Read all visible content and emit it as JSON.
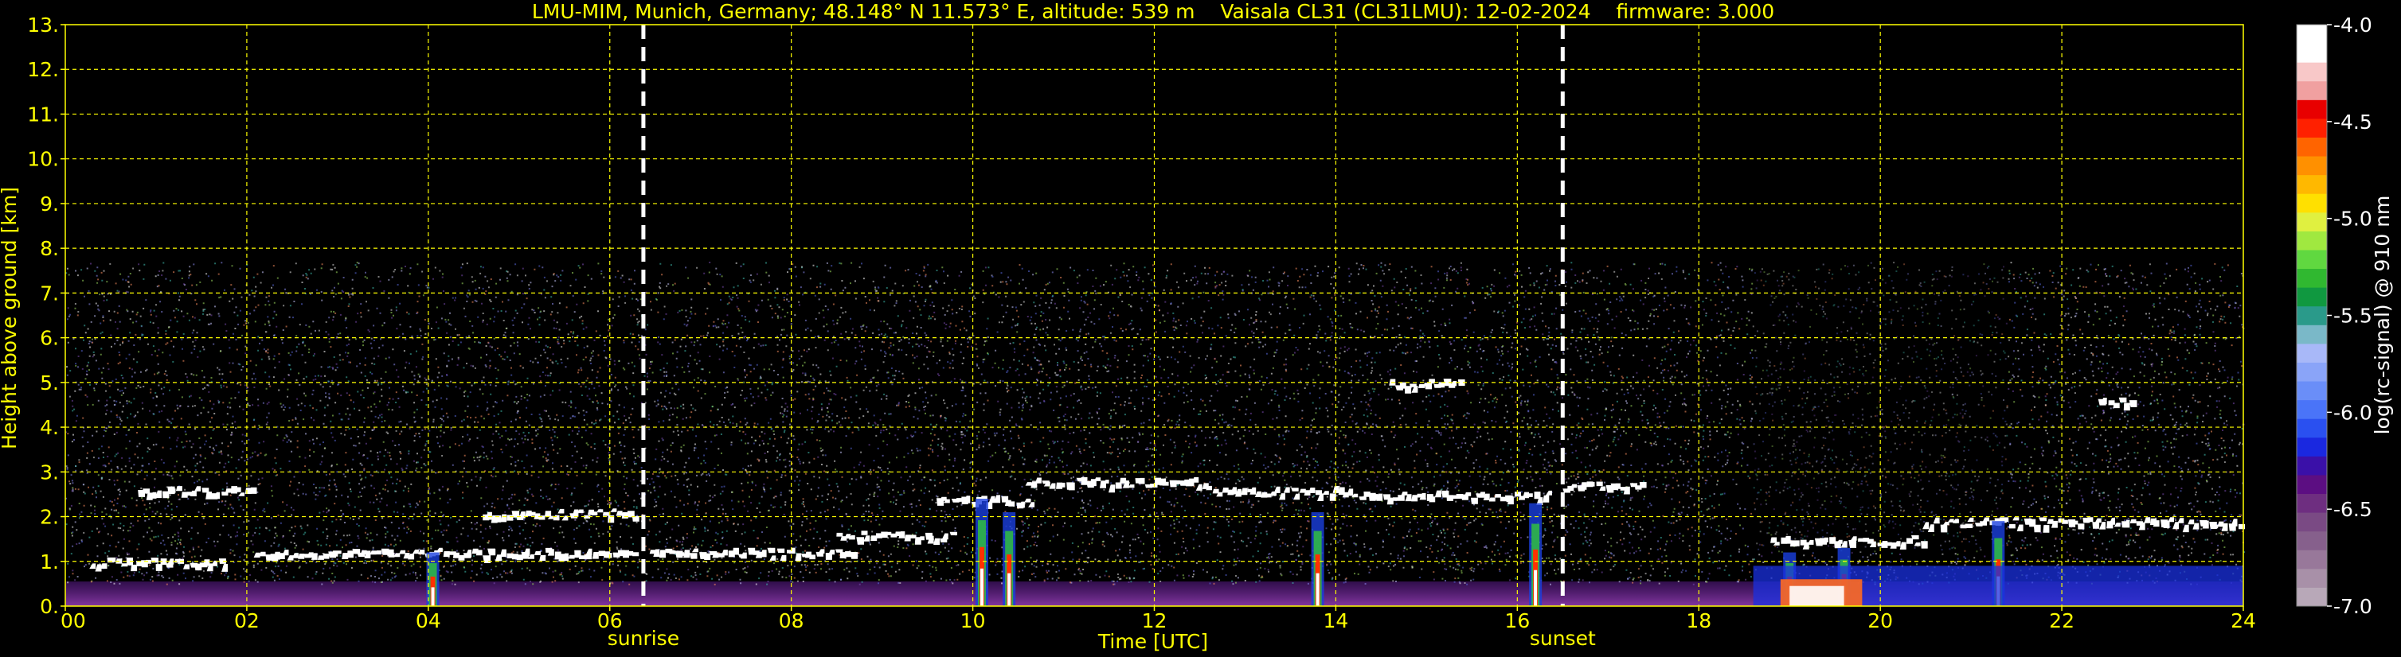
{
  "chart_data": {
    "type": "heatmap",
    "title": "LMU-MIM, Munich, Germany; 48.148° N 11.573° E, altitude: 539 m    Vaisala CL31 (CL31LMU): 12-02-2024    firmware: 3.000",
    "xlabel": "Time [UTC]",
    "ylabel": "Height above ground [km]",
    "xlim": [
      0,
      24
    ],
    "ylim": [
      0,
      13
    ],
    "x_ticks": [
      0,
      2,
      4,
      6,
      8,
      10,
      12,
      14,
      16,
      18,
      20,
      22,
      24
    ],
    "x_tick_labels": [
      "00",
      "02",
      "04",
      "06",
      "08",
      "10",
      "12",
      "14",
      "16",
      "18",
      "20",
      "22",
      "24"
    ],
    "y_ticks": [
      0,
      1,
      2,
      3,
      4,
      5,
      6,
      7,
      8,
      9,
      10,
      11,
      12,
      13
    ],
    "y_tick_labels": [
      "0.",
      "1.",
      "2.",
      "3.",
      "4.",
      "5.",
      "6.",
      "7.",
      "8.",
      "9.",
      "10.",
      "11.",
      "12.",
      "13."
    ],
    "grid": true,
    "grid_color": "#ffff00",
    "signal_top_km": 7.7,
    "events": [
      {
        "label": "sunrise",
        "time": 6.37
      },
      {
        "label": "sunset",
        "time": 16.5
      }
    ],
    "colorbar": {
      "label": "log(rc-signal) @ 910 nm",
      "range": [
        -7.0,
        -4.0
      ],
      "tick_values": [
        -4.0,
        -4.5,
        -5.0,
        -5.5,
        -6.0,
        -6.5,
        -7.0
      ],
      "tick_labels": [
        "-4.0",
        "-4.5",
        "-5.0",
        "-5.5",
        "-6.0",
        "-6.5",
        "-7.0"
      ],
      "colors": [
        "#b8a8b8",
        "#a890a8",
        "#98789a",
        "#86608c",
        "#7a4a84",
        "#6e2e80",
        "#5c0e82",
        "#3a10a8",
        "#1a28e0",
        "#2a50f0",
        "#4a74f8",
        "#6a8ef8",
        "#8aa4f8",
        "#a8b8f8",
        "#7ab8c8",
        "#2a9a8a",
        "#109840",
        "#30b830",
        "#60d840",
        "#a0e840",
        "#e0f040",
        "#ffe000",
        "#ffb800",
        "#ff9000",
        "#ff6400",
        "#ff2000",
        "#e80000",
        "#f0a0a0",
        "#f8c8c8",
        "#ffffff",
        "#ffffff"
      ]
    },
    "cloud_layers": [
      {
        "t0": 0.8,
        "t1": 2.1,
        "h": 2.6
      },
      {
        "t0": 2.1,
        "t1": 6.3,
        "h": 1.22
      },
      {
        "t0": 0.3,
        "t1": 1.8,
        "h": 1.0
      },
      {
        "t0": 4.6,
        "t1": 6.3,
        "h": 2.1
      },
      {
        "t0": 6.45,
        "t1": 8.7,
        "h": 1.22
      },
      {
        "t0": 8.5,
        "t1": 9.8,
        "h": 1.6
      },
      {
        "t0": 9.6,
        "t1": 10.7,
        "h": 2.4
      },
      {
        "t0": 10.6,
        "t1": 12.6,
        "h": 2.8
      },
      {
        "t0": 12.6,
        "t1": 14.2,
        "h": 2.6
      },
      {
        "t0": 14.2,
        "t1": 16.4,
        "h": 2.5
      },
      {
        "t0": 16.5,
        "t1": 17.4,
        "h": 2.7
      },
      {
        "t0": 18.8,
        "t1": 20.5,
        "h": 1.5
      },
      {
        "t0": 20.5,
        "t1": 21.8,
        "h": 1.9
      },
      {
        "t0": 21.8,
        "t1": 24.0,
        "h": 1.9
      },
      {
        "t0": 14.6,
        "t1": 15.4,
        "h": 5.0
      },
      {
        "t0": 22.4,
        "t1": 22.8,
        "h": 4.6
      }
    ],
    "precip_plumes": [
      {
        "t": 4.05,
        "top": 1.2
      },
      {
        "t": 10.1,
        "top": 2.4
      },
      {
        "t": 10.4,
        "top": 2.1
      },
      {
        "t": 13.8,
        "top": 2.1
      },
      {
        "t": 16.2,
        "top": 2.3
      },
      {
        "t": 19.0,
        "top": 1.2
      },
      {
        "t": 19.6,
        "top": 1.3
      },
      {
        "t": 21.3,
        "top": 1.9
      }
    ]
  }
}
